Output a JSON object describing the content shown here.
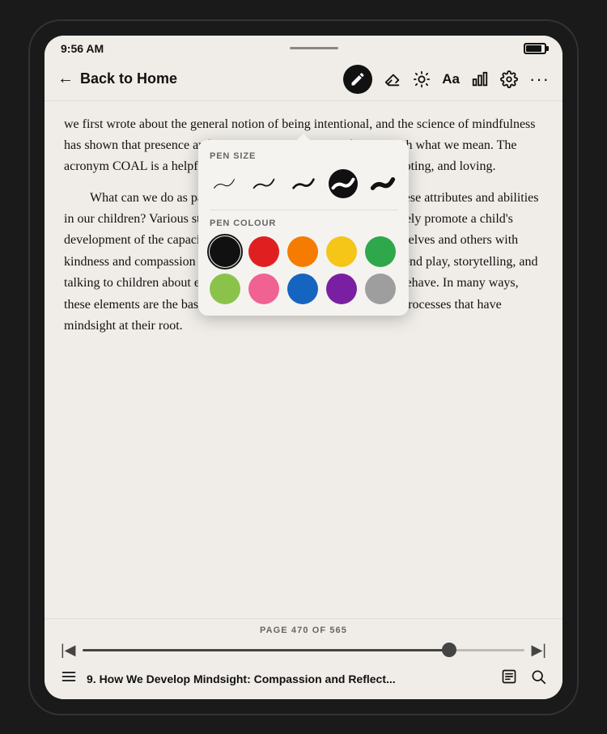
{
  "device": {
    "time": "9:56 AM"
  },
  "header": {
    "back_label": "Back to Home",
    "title": "Back to Home"
  },
  "toolbar": {
    "icons": [
      "pen",
      "eraser",
      "brightness",
      "text",
      "chart",
      "settings",
      "more"
    ]
  },
  "popup": {
    "pen_size_label": "PEN SIZE",
    "pen_colour_label": "PEN COLOUR",
    "sizes": [
      {
        "id": "xs",
        "selected": false
      },
      {
        "id": "sm",
        "selected": false
      },
      {
        "id": "md",
        "selected": false
      },
      {
        "id": "lg",
        "selected": true
      },
      {
        "id": "xl",
        "selected": false
      }
    ],
    "colors": [
      {
        "name": "black",
        "hex": "#111111",
        "selected": true
      },
      {
        "name": "red",
        "hex": "#e02020",
        "selected": false
      },
      {
        "name": "orange",
        "hex": "#f57c00",
        "selected": false
      },
      {
        "name": "yellow",
        "hex": "#f5c518",
        "selected": false
      },
      {
        "name": "green",
        "hex": "#2ea84a",
        "selected": false
      },
      {
        "name": "lime",
        "hex": "#8bc34a",
        "selected": false
      },
      {
        "name": "pink",
        "hex": "#f06292",
        "selected": false
      },
      {
        "name": "blue",
        "hex": "#1565c0",
        "selected": false
      },
      {
        "name": "purple",
        "hex": "#7b1fa2",
        "selected": false
      },
      {
        "name": "gray",
        "hex": "#9e9e9e",
        "selected": false
      }
    ]
  },
  "content": {
    "paragraphs": [
      "we first wrote about the general notion of being intentional, and the science of mindfulness has shown that presence and open awareness overlaps directly with what we mean. The acronym COAL is a helpful way to remember curious, open, accepting, and loving.",
      "What can we do as parents to promote the development of these attributes and abilities in our children? Various studies have shown that parents can actively promote a child's development of the capacity to understand the inner lives of themselves and others with kindness and compassion by engaging in interactions such as pretend play, storytelling, and talking to children about emotions and their impact on how they behave. In many ways, these elements are the basis of social and emotional intelligence, processes that have mindsight at their root."
    ]
  },
  "footer": {
    "page_indicator": "PAGE 470 OF 565",
    "progress_percent": 83,
    "chapter_title": "9. How We Develop Mindsight: Compassion and Reflect..."
  }
}
